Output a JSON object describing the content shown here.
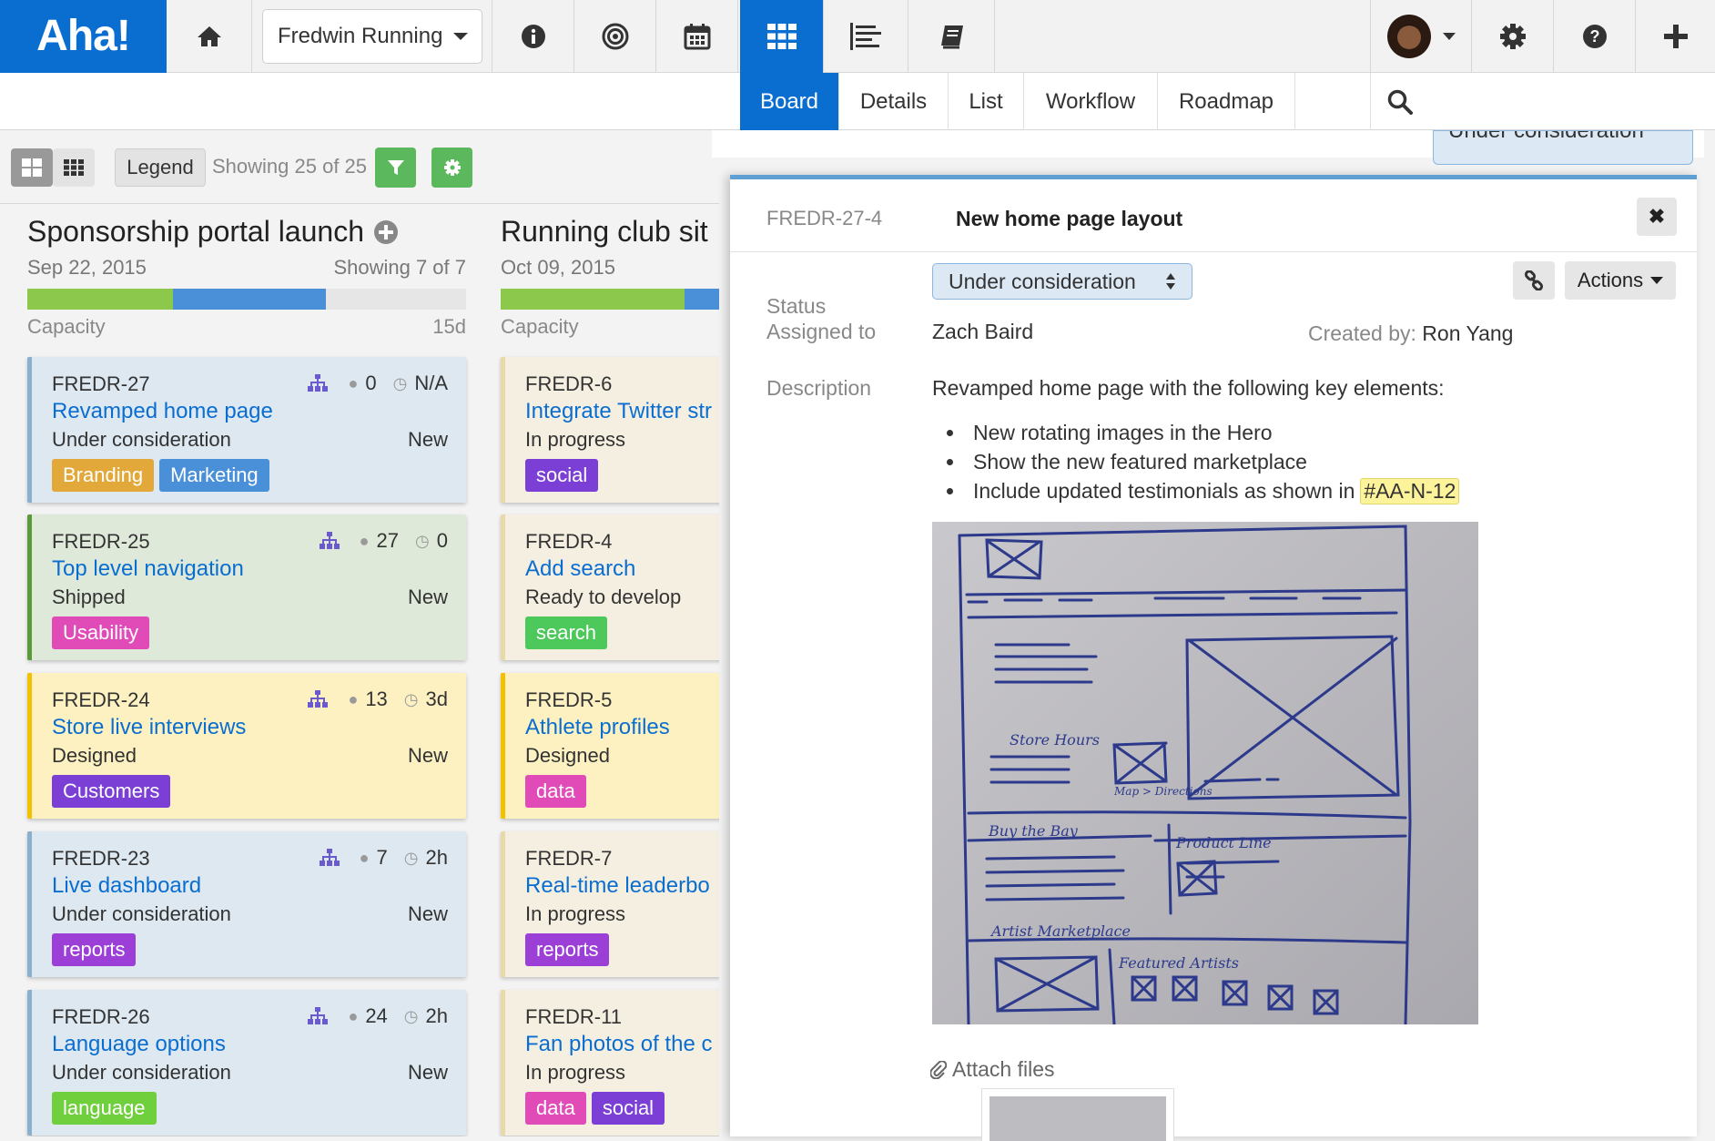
{
  "app": {
    "logo": "Aha!"
  },
  "topnav": {
    "workspace": "Fredwin Running",
    "icons": [
      "home-icon",
      "info-icon",
      "target-icon",
      "calendar-icon",
      "board-icon",
      "list-lines-icon",
      "book-icon",
      "settings-icon",
      "help-icon",
      "plus-icon"
    ]
  },
  "subnav": {
    "tabs": [
      "Board",
      "Details",
      "List",
      "Workflow",
      "Roadmap"
    ],
    "active": "Board"
  },
  "toolbar": {
    "legend": "Legend",
    "showing": "Showing 25 of 25"
  },
  "columns": [
    {
      "title": "Sponsorship portal launch",
      "date": "Sep 22, 2015",
      "showing": "Showing 7 of 7",
      "capacity_label": "Capacity",
      "capacity_days": "15d",
      "cards": [
        {
          "id": "FREDR-27",
          "title": "Revamped home page",
          "status": "Under consideration",
          "type": "New",
          "count": "0",
          "time": "N/A",
          "tags": [
            "Branding",
            "Marketing"
          ]
        },
        {
          "id": "FREDR-25",
          "title": "Top level navigation",
          "status": "Shipped",
          "type": "New",
          "count": "27",
          "time": "0",
          "tags": [
            "Usability"
          ]
        },
        {
          "id": "FREDR-24",
          "title": "Store live interviews",
          "status": "Designed",
          "type": "New",
          "count": "13",
          "time": "3d",
          "tags": [
            "Customers"
          ]
        },
        {
          "id": "FREDR-23",
          "title": "Live dashboard",
          "status": "Under consideration",
          "type": "New",
          "count": "7",
          "time": "2h",
          "tags": [
            "reports"
          ]
        },
        {
          "id": "FREDR-26",
          "title": "Language options",
          "status": "Under consideration",
          "type": "New",
          "count": "24",
          "time": "2h",
          "tags": [
            "language"
          ]
        }
      ]
    },
    {
      "title": "Running club sit",
      "date": "Oct 09, 2015",
      "capacity_label": "Capacity",
      "cards": [
        {
          "id": "FREDR-6",
          "title": "Integrate Twitter str",
          "status": "In progress",
          "tags": [
            "social"
          ]
        },
        {
          "id": "FREDR-4",
          "title": "Add search",
          "status": "Ready to develop",
          "tags": [
            "search"
          ]
        },
        {
          "id": "FREDR-5",
          "title": "Athlete profiles",
          "status": "Designed",
          "tags": [
            "data"
          ]
        },
        {
          "id": "FREDR-7",
          "title": "Real-time leaderbo",
          "status": "In progress",
          "tags": [
            "reports"
          ]
        },
        {
          "id": "FREDR-11",
          "title": "Fan photos of the c",
          "status": "In progress",
          "tags": [
            "data",
            "social"
          ]
        }
      ]
    }
  ],
  "drawer": {
    "peek_status": "Under consideration",
    "id": "FREDR-27-4",
    "title": "New home page layout",
    "close": "✖",
    "status_label": "Status",
    "status_value": "Under consideration",
    "actions": "Actions",
    "assigned_label": "Assigned to",
    "assigned_value": "Zach Baird",
    "created_label": "Created by:",
    "created_value": "Ron Yang",
    "description_label": "Description",
    "description_intro": "Revamped home page with the following key elements:",
    "bullets": [
      "New rotating images in the Hero",
      "Show the new featured marketplace",
      "Include updated testimonials as shown in"
    ],
    "bullet_ref": "#AA-N-12",
    "attach": "Attach files",
    "sketch_labels": [
      "Store Hours",
      "Map > Directions",
      "Buy the Bay",
      "Product Line",
      "Artist Marketplace",
      "Featured Artists"
    ]
  },
  "colors": {
    "accent": "#0a6ed1",
    "green": "#5cb85c",
    "tag_orange": "#e2a93a",
    "tag_blue": "#4a90d9",
    "tag_pink": "#e04bb8",
    "tag_purple": "#7b3fd6",
    "tag_green": "#6fcf3c",
    "card_blue": "#dde8f0",
    "card_green": "#dfe9d9",
    "card_yellow": "#fdf1c2",
    "card_beige": "#f5efe1"
  }
}
